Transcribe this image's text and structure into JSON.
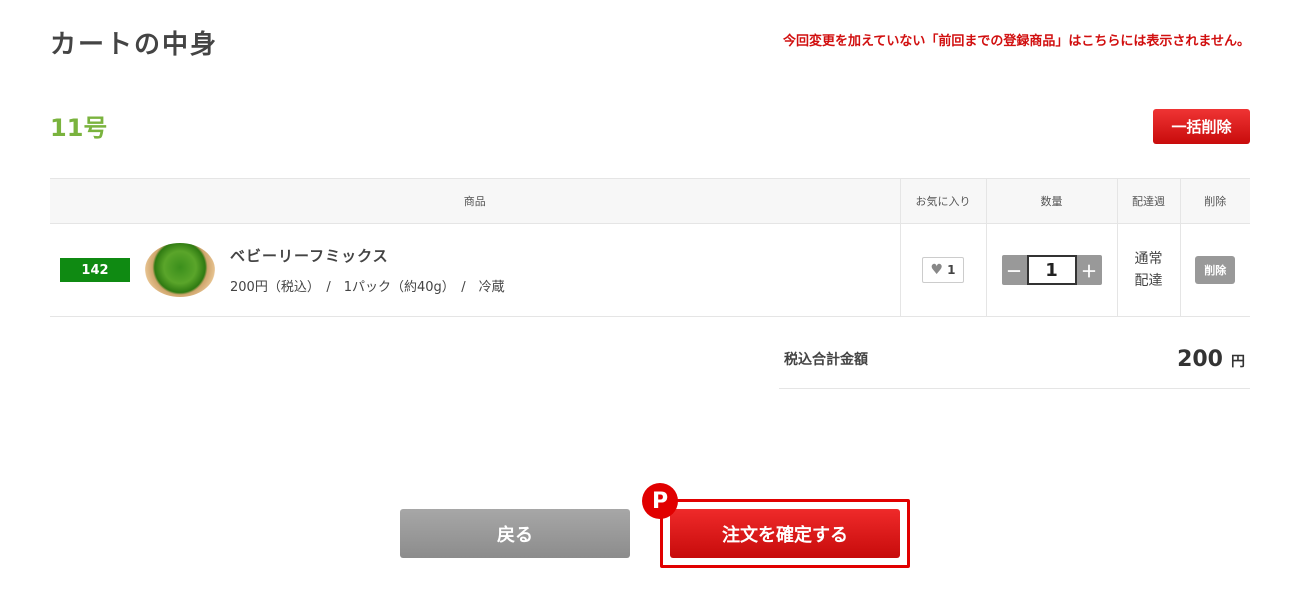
{
  "header": {
    "title": "カートの中身",
    "notice": "今回変更を加えていない「前回までの登録商品」はこちらには表示されません。"
  },
  "cart": {
    "name": "11号",
    "bulk_delete_label": "一括削除"
  },
  "table": {
    "headers": {
      "product": "商品",
      "favorite": "お気に入り",
      "quantity": "数量",
      "delivery_week": "配達週",
      "delete": "削除"
    },
    "rows": [
      {
        "code": "142",
        "name": "ベビーリーフミックス",
        "description": "200円（税込）　/　1パック（約40g）　/　冷蔵",
        "favorite_count": "1",
        "quantity": "1",
        "minus_label": "－",
        "plus_label": "＋",
        "delivery_line1": "通常",
        "delivery_line2": "配達",
        "delete_label": "削除"
      }
    ]
  },
  "total": {
    "label": "税込合計金額",
    "amount": "200",
    "unit": "円"
  },
  "actions": {
    "back_label": "戻る",
    "confirm_label": "注文を確定する",
    "point_badge": "P"
  },
  "colors": {
    "accent_red": "#e10000",
    "cart_name_green": "#7ab33e",
    "code_badge_green": "#0f8a12",
    "notice_red": "#d10f0f"
  },
  "icons": {
    "favorite": "heart-icon",
    "thumbnail": "baby-leaf-salad-photo"
  }
}
